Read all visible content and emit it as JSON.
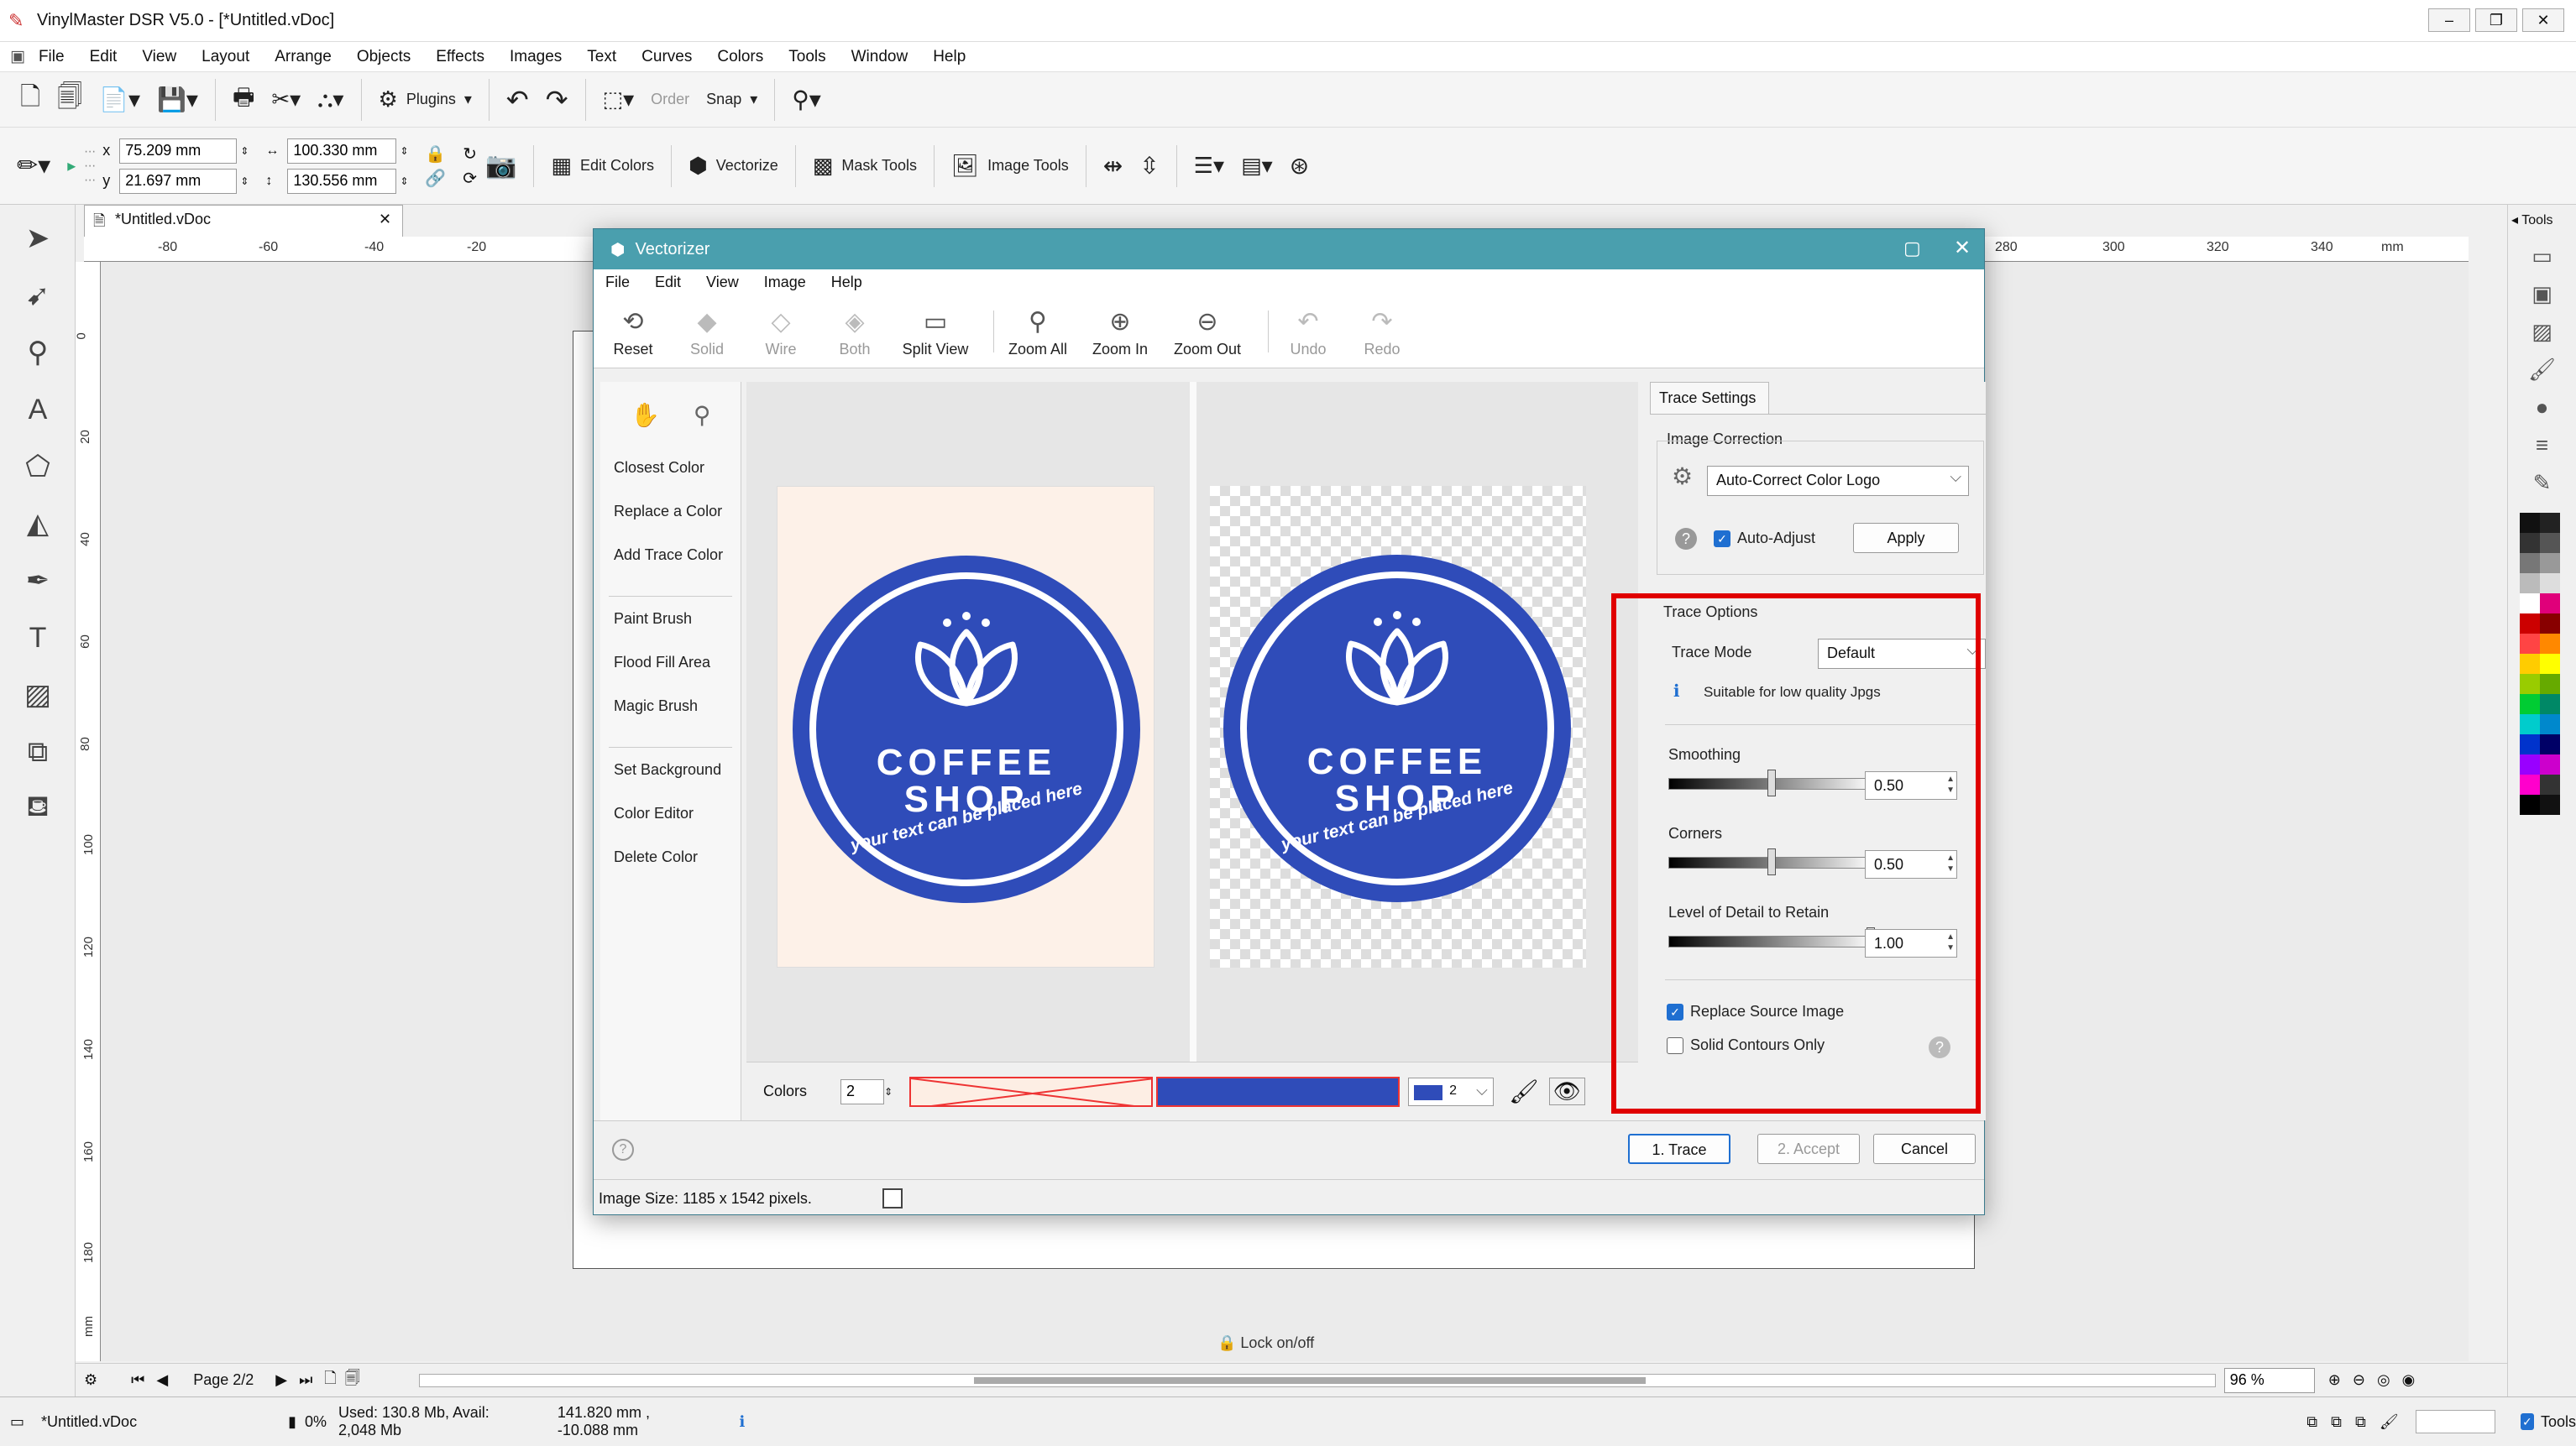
{
  "app": {
    "title": "VinylMaster DSR V5.0 - [*Untitled.vDoc]",
    "menu": [
      "File",
      "Edit",
      "View",
      "Layout",
      "Arrange",
      "Objects",
      "Effects",
      "Images",
      "Text",
      "Curves",
      "Colors",
      "Tools",
      "Window",
      "Help"
    ],
    "toolbar1": {
      "plugins": "Plugins",
      "order": "Order",
      "snap": "Snap"
    },
    "toolbar2": {
      "x_label": "x",
      "y_label": "y",
      "x_value": "75.209 mm",
      "y_value": "21.697 mm",
      "w_value": "100.330 mm",
      "h_value": "130.556 mm",
      "edit_colors": "Edit Colors",
      "vectorize": "Vectorize",
      "mask_tools": "Mask Tools",
      "image_tools": "Image Tools"
    },
    "doc_tab": "*Untitled.vDoc",
    "ruler_h": [
      "-80",
      "-60",
      "-40",
      "-20",
      "280",
      "300",
      "320",
      "340",
      "mm"
    ],
    "ruler_v": [
      "0",
      "20",
      "40",
      "60",
      "80",
      "100",
      "120",
      "140",
      "160",
      "180",
      "mm"
    ],
    "lock_label": "Lock on/off",
    "page_label": "Page 2/2",
    "zoom": "96 %",
    "status": {
      "doc": "*Untitled.vDoc",
      "mem_pct": "0%",
      "mem": "Used: 130.8 Mb, Avail: 2,048 Mb",
      "coords": "141.820 mm , -10.088 mm",
      "tools": "Tools"
    },
    "right_panel_title": "Tools"
  },
  "dialog": {
    "title": "Vectorizer",
    "menu": [
      "File",
      "Edit",
      "View",
      "Image",
      "Help"
    ],
    "toolbar": [
      {
        "label": "Reset",
        "icon": "reset-icon",
        "enabled": true
      },
      {
        "label": "Solid",
        "icon": "solid-icon",
        "enabled": false
      },
      {
        "label": "Wire",
        "icon": "wire-icon",
        "enabled": false
      },
      {
        "label": "Both",
        "icon": "both-icon",
        "enabled": false
      },
      {
        "label": "Split View",
        "icon": "split-view-icon",
        "enabled": true
      },
      {
        "label": "Zoom All",
        "icon": "zoom-all-icon",
        "enabled": true
      },
      {
        "label": "Zoom In",
        "icon": "zoom-in-icon",
        "enabled": true
      },
      {
        "label": "Zoom Out",
        "icon": "zoom-out-icon",
        "enabled": true
      },
      {
        "label": "Undo",
        "icon": "undo-icon",
        "enabled": false
      },
      {
        "label": "Redo",
        "icon": "redo-icon",
        "enabled": false
      }
    ],
    "side_tools": {
      "closest": "Closest Color",
      "replace": "Replace a Color",
      "add": "Add Trace Color",
      "paint": "Paint Brush",
      "flood": "Flood Fill Area",
      "magic": "Magic Brush",
      "setbg": "Set Background",
      "coloreditor": "Color Editor",
      "delete": "Delete Color"
    },
    "logo": {
      "line1": "COFFEE",
      "line2": "SHOP",
      "tagline": "your text can be placed here"
    },
    "colors_label": "Colors",
    "colors_count": "2",
    "color_select": "2",
    "trace_settings_tab": "Trace Settings",
    "image_correction": {
      "group": "Image Correction",
      "preset": "Auto-Correct Color Logo",
      "auto_adjust": "Auto-Adjust",
      "apply": "Apply"
    },
    "trace_options": {
      "group": "Trace Options",
      "mode_label": "Trace Mode",
      "mode_value": "Default",
      "hint": "Suitable for low quality Jpgs",
      "smoothing_label": "Smoothing",
      "smoothing_value": "0.50",
      "corners_label": "Corners",
      "corners_value": "0.50",
      "detail_label": "Level of Detail to Retain",
      "detail_value": "1.00",
      "replace_source": "Replace Source Image",
      "solid_contours": "Solid Contours Only"
    },
    "buttons": {
      "trace": "1. Trace",
      "accept": "2. Accept",
      "cancel": "Cancel"
    },
    "image_size": "Image Size: 1185 x 1542 pixels."
  },
  "colors": {
    "accent": "#4a9fae",
    "logo_blue": "#2f4cb9",
    "highlight": "#e00000"
  }
}
